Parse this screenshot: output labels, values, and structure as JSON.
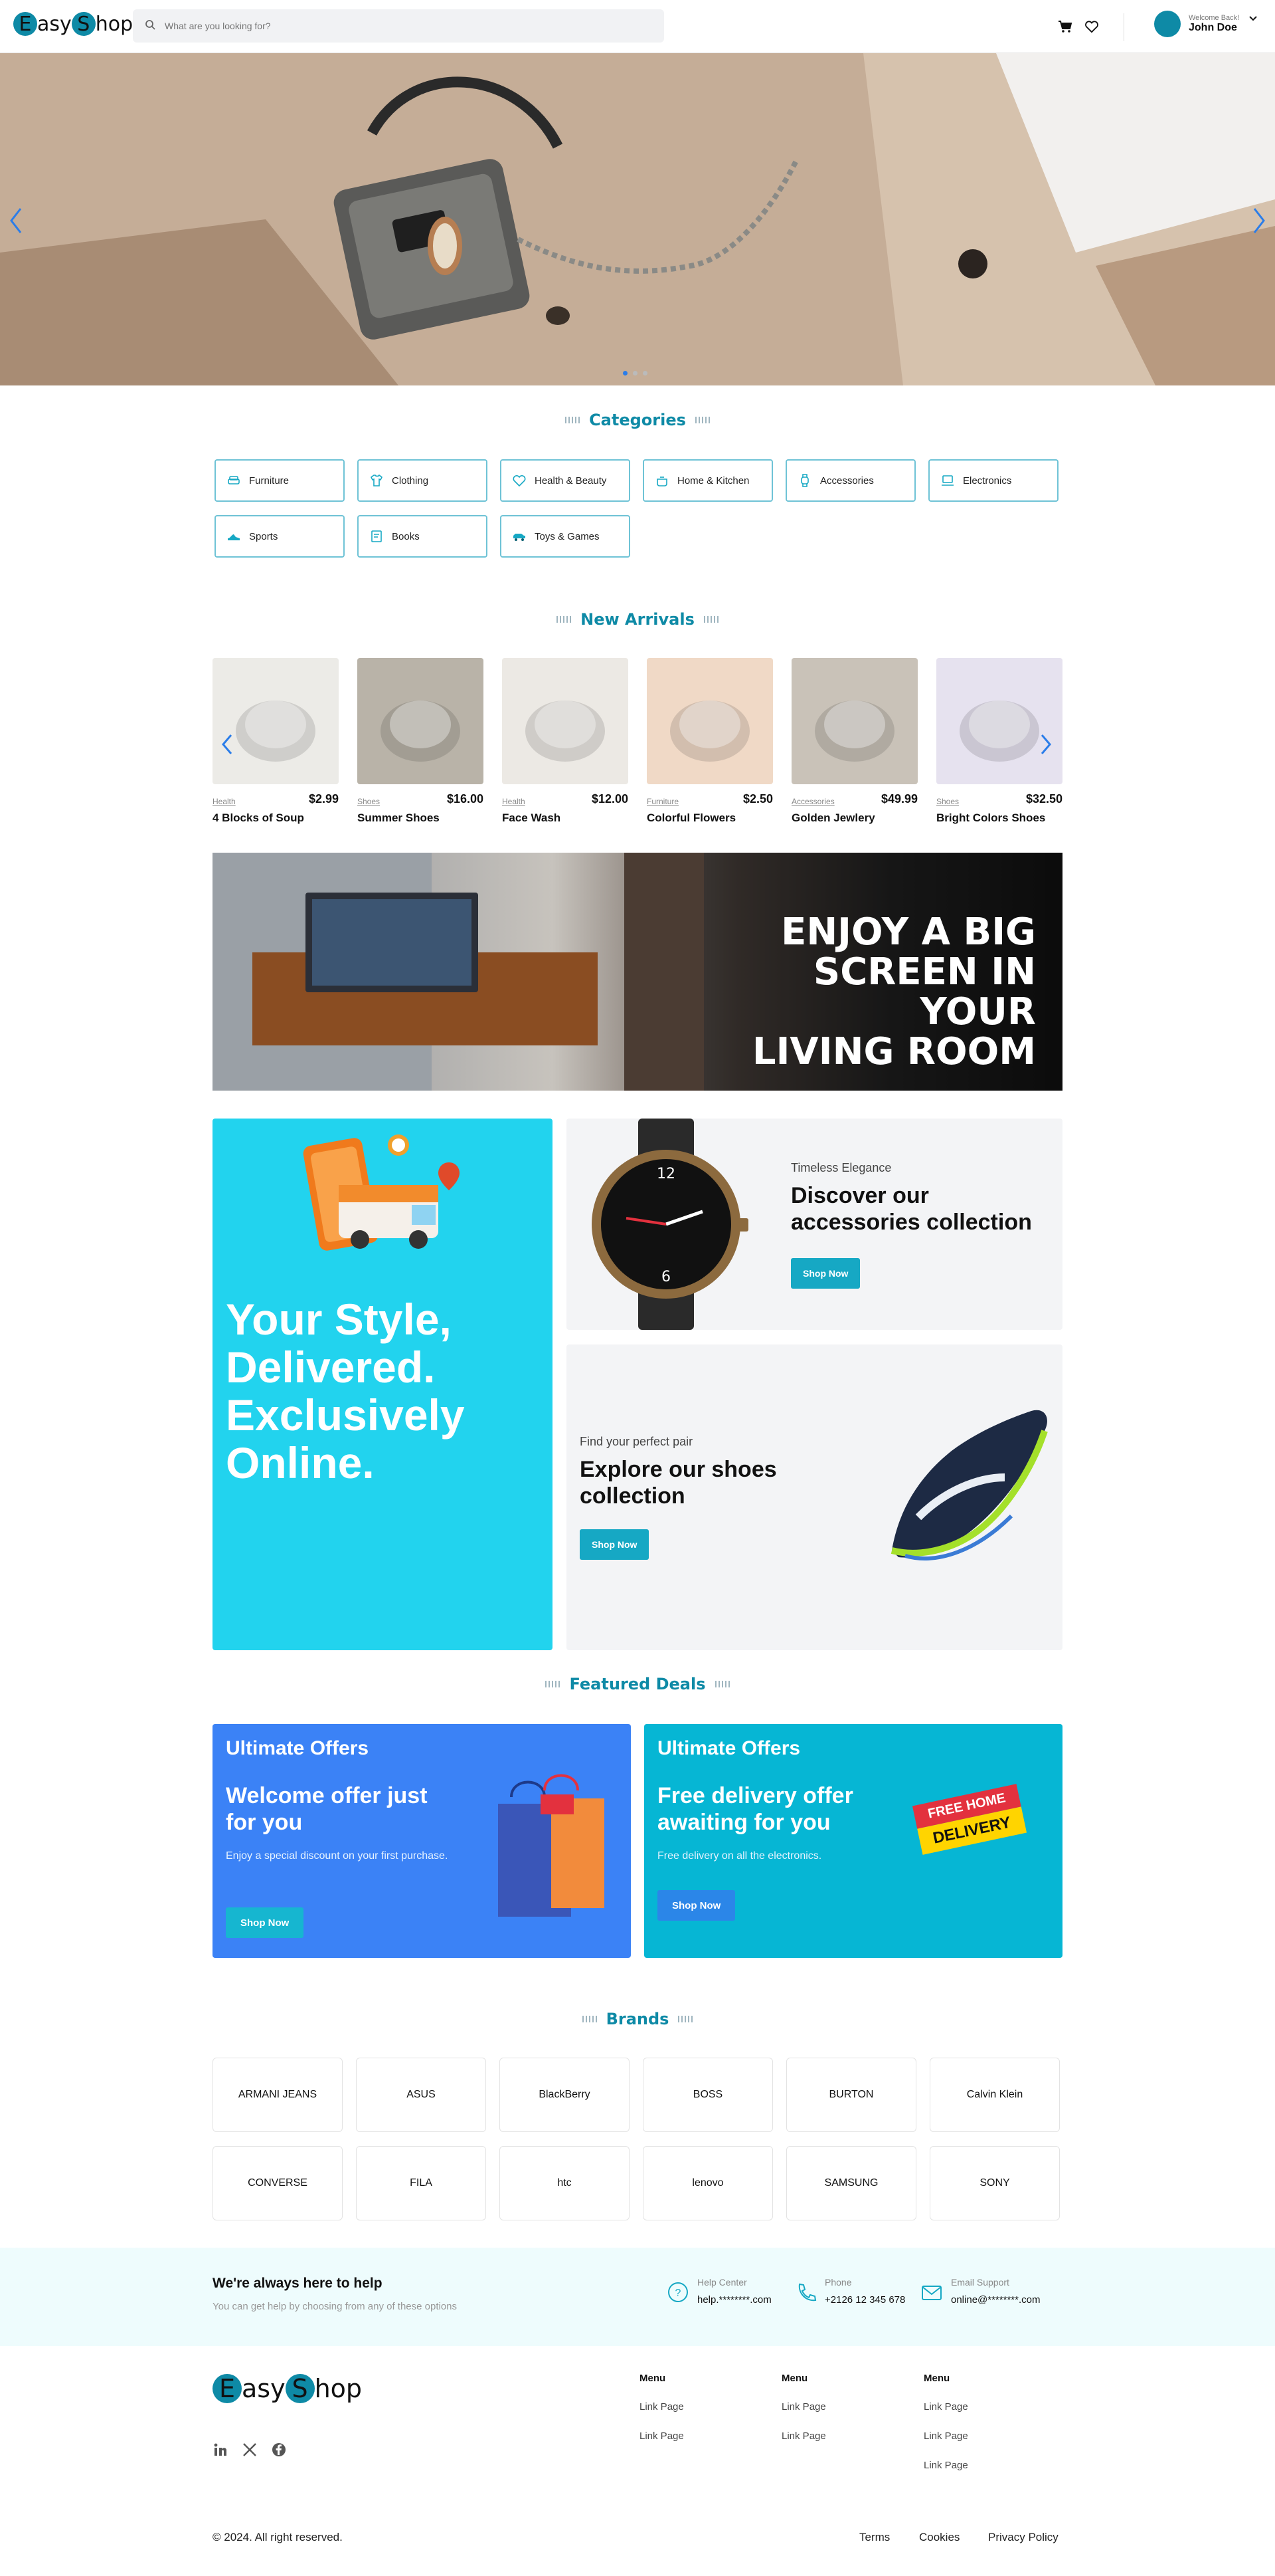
{
  "header": {
    "logo": {
      "first": "E",
      "rest1": "asy",
      "second": "S",
      "rest2": "hop"
    },
    "search": {
      "placeholder": "What are you looking for?"
    },
    "icons": [
      "cart-icon",
      "heart-icon",
      "chevron-down-icon"
    ],
    "user": {
      "greeting": "Welcome Back!",
      "name": "John Doe"
    }
  },
  "hero": {
    "slides": 3,
    "active_slide": 1
  },
  "categories": {
    "title": "Categories",
    "items": [
      {
        "label": "Furniture",
        "icon": "sofa-icon"
      },
      {
        "label": "Clothing",
        "icon": "shirt-icon"
      },
      {
        "label": "Health & Beauty",
        "icon": "heart-icon"
      },
      {
        "label": "Home & Kitchen",
        "icon": "pot-icon"
      },
      {
        "label": "Accessories",
        "icon": "watch-icon"
      },
      {
        "label": "Electronics",
        "icon": "laptop-icon"
      },
      {
        "label": "Sports",
        "icon": "sneaker-icon"
      },
      {
        "label": "Books",
        "icon": "book-icon"
      },
      {
        "label": "Toys & Games",
        "icon": "toy-car-icon"
      }
    ]
  },
  "new_arrivals": {
    "title": "New Arrivals",
    "products": [
      {
        "category": "Health",
        "price": "$2.99",
        "name": "4 Blocks of Soup",
        "color": "#ecebe7"
      },
      {
        "category": "Shoes",
        "price": "$16.00",
        "name": "Summer Shoes",
        "color": "#b9b3a8"
      },
      {
        "category": "Health",
        "price": "$12.00",
        "name": "Face Wash",
        "color": "#ece9e4"
      },
      {
        "category": "Furniture",
        "price": "$2.50",
        "name": "Colorful Flowers",
        "color": "#f0d9c6"
      },
      {
        "category": "Accessories",
        "price": "$49.99",
        "name": "Golden Jewlery",
        "color": "#c9c2b8"
      },
      {
        "category": "Shoes",
        "price": "$32.50",
        "name": "Bright Colors Shoes",
        "color": "#e6e2ef"
      }
    ]
  },
  "tv_banner": {
    "lines": [
      "ENJOY A BIG",
      "SCREEN IN YOUR",
      "LIVING ROOM"
    ]
  },
  "promo": {
    "headline_lines": [
      "Your Style,",
      "Delivered.",
      "Exclusively",
      "Online."
    ],
    "accessories": {
      "kicker": "Timeless Elegance",
      "title": "Discover our accessories collection",
      "button": "Shop Now"
    },
    "shoes": {
      "kicker": "Find your perfect pair",
      "title": "Explore our shoes collection",
      "button": "Shop Now"
    }
  },
  "featured_deals": {
    "title": "Featured Deals",
    "deals": [
      {
        "kicker": "Ultimate Offers",
        "title": "Welcome offer just for you",
        "text": "Enjoy a special discount on your first purchase.",
        "button": "Shop Now",
        "color": "#3b82f6"
      },
      {
        "kicker": "Ultimate Offers",
        "title": "Free delivery offer awaiting for you",
        "text": "Free delivery on all the electronics.",
        "button": "Shop Now",
        "color": "#06b6d4",
        "badge": [
          "FREE HOME",
          "DELIVERY"
        ]
      }
    ]
  },
  "brands": {
    "title": "Brands",
    "items": [
      "ARMANI JEANS",
      "ASUS",
      "BlackBerry",
      "BOSS",
      "BURTON",
      "Calvin Klein",
      "CONVERSE",
      "FILA",
      "htc",
      "lenovo",
      "SAMSUNG",
      "SONY"
    ]
  },
  "help": {
    "title": "We're always here to help",
    "subtitle": "You can get help by choosing from any of these options",
    "items": [
      {
        "label": "Help Center",
        "value": "help.********.com",
        "icon": "question-icon"
      },
      {
        "label": "Phone",
        "value": "+2126 12 345 678",
        "icon": "phone-icon"
      },
      {
        "label": "Email Support",
        "value": "online@********.com",
        "icon": "mail-icon"
      }
    ]
  },
  "footer": {
    "menus": [
      {
        "title": "Menu",
        "links": [
          "Link Page",
          "Link Page"
        ]
      },
      {
        "title": "Menu",
        "links": [
          "Link Page",
          "Link Page"
        ]
      },
      {
        "title": "Menu",
        "links": [
          "Link Page",
          "Link Page",
          "Link Page"
        ]
      }
    ],
    "social": [
      "linkedin-icon",
      "x-icon",
      "facebook-icon"
    ],
    "copyright": "© 2024. All right reserved.",
    "legal": [
      "Terms",
      "Cookies",
      "Privacy Policy"
    ]
  },
  "colors": {
    "accent": "#0e8aa6",
    "cyan": "#22d3ee",
    "blue": "#3b82f6",
    "help_bg": "#eefcfd"
  }
}
